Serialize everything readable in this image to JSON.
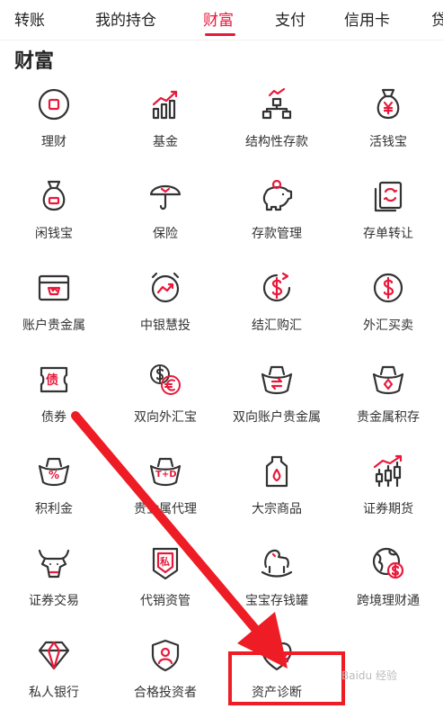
{
  "tabs": [
    {
      "label": "转账",
      "active": false
    },
    {
      "label": "我的持仓",
      "active": false
    },
    {
      "label": "财富",
      "active": true
    },
    {
      "label": "支付",
      "active": false
    },
    {
      "label": "信用卡",
      "active": false
    },
    {
      "label": "贷",
      "active": false
    }
  ],
  "section_title": "财富",
  "items": [
    {
      "label": "理财",
      "icon": "wealth-management-icon"
    },
    {
      "label": "基金",
      "icon": "fund-chart-icon"
    },
    {
      "label": "结构性存款",
      "icon": "structured-deposit-icon"
    },
    {
      "label": "活钱宝",
      "icon": "money-bag-yuan-icon"
    },
    {
      "label": "闲钱宝",
      "icon": "money-bag-icon"
    },
    {
      "label": "保险",
      "icon": "umbrella-icon"
    },
    {
      "label": "存款管理",
      "icon": "piggy-bank-icon"
    },
    {
      "label": "存单转让",
      "icon": "certificate-transfer-icon"
    },
    {
      "label": "账户贵金属",
      "icon": "gold-account-icon"
    },
    {
      "label": "中银慧投",
      "icon": "smart-invest-icon"
    },
    {
      "label": "结汇购汇",
      "icon": "currency-exchange-icon"
    },
    {
      "label": "外汇买卖",
      "icon": "forex-dollar-icon"
    },
    {
      "label": "债券",
      "icon": "bond-ticket-icon"
    },
    {
      "label": "双向外汇宝",
      "icon": "dollar-euro-icon"
    },
    {
      "label": "双向账户贵金属",
      "icon": "gold-ingot-exchange-icon"
    },
    {
      "label": "贵金属积存",
      "icon": "gold-ingot-icon"
    },
    {
      "label": "积利金",
      "icon": "percent-ingot-icon"
    },
    {
      "label": "贵金属代理",
      "icon": "td-ingot-icon"
    },
    {
      "label": "大宗商品",
      "icon": "oil-barrel-icon"
    },
    {
      "label": "证券期货",
      "icon": "candlestick-icon"
    },
    {
      "label": "证券交易",
      "icon": "bull-icon"
    },
    {
      "label": "代销资管",
      "icon": "private-shield-icon"
    },
    {
      "label": "宝宝存钱罐",
      "icon": "rocking-horse-icon"
    },
    {
      "label": "跨境理财通",
      "icon": "globe-dollar-icon"
    },
    {
      "label": "私人银行",
      "icon": "diamond-icon"
    },
    {
      "label": "合格投资者",
      "icon": "qualified-investor-icon"
    },
    {
      "label": "资产诊断",
      "icon": "asset-diagnosis-icon"
    }
  ],
  "watermark": "Baidu 经验",
  "colors": {
    "accent": "#e8193b",
    "icon": "#333333",
    "highlight": "#ee1c24"
  }
}
